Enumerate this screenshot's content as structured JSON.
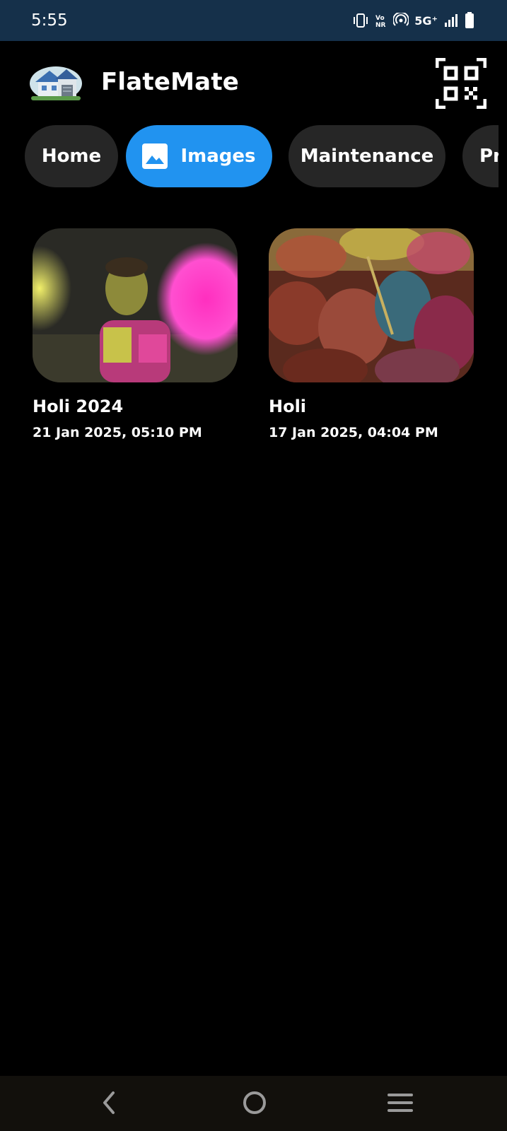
{
  "status_bar": {
    "time": "5:55",
    "network": "5G⁺",
    "icons": [
      "vibrate-icon",
      "volte-icon",
      "hotspot-icon",
      "signal-icon",
      "battery-icon"
    ]
  },
  "header": {
    "app_title": "FlateMate",
    "logo_icon": "house-logo-icon",
    "qr_icon": "qr-code-icon"
  },
  "tabs": [
    {
      "label": "Home",
      "active": false
    },
    {
      "label": "Images",
      "active": true,
      "icon": "image-icon"
    },
    {
      "label": "Maintenance",
      "active": false
    },
    {
      "label": "Pr",
      "active": false
    }
  ],
  "gallery": [
    {
      "title": "Holi 2024",
      "date": "21 Jan 2025, 05:10 PM"
    },
    {
      "title": "Holi",
      "date": "17 Jan 2025, 04:04 PM"
    }
  ],
  "nav": {
    "icons": [
      "back-icon",
      "home-icon",
      "recents-icon"
    ]
  },
  "colors": {
    "status_bar": "#15304a",
    "background": "#000000",
    "tab_active": "#2193f0",
    "tab_inactive": "#262626",
    "nav_bar": "#12100c"
  }
}
